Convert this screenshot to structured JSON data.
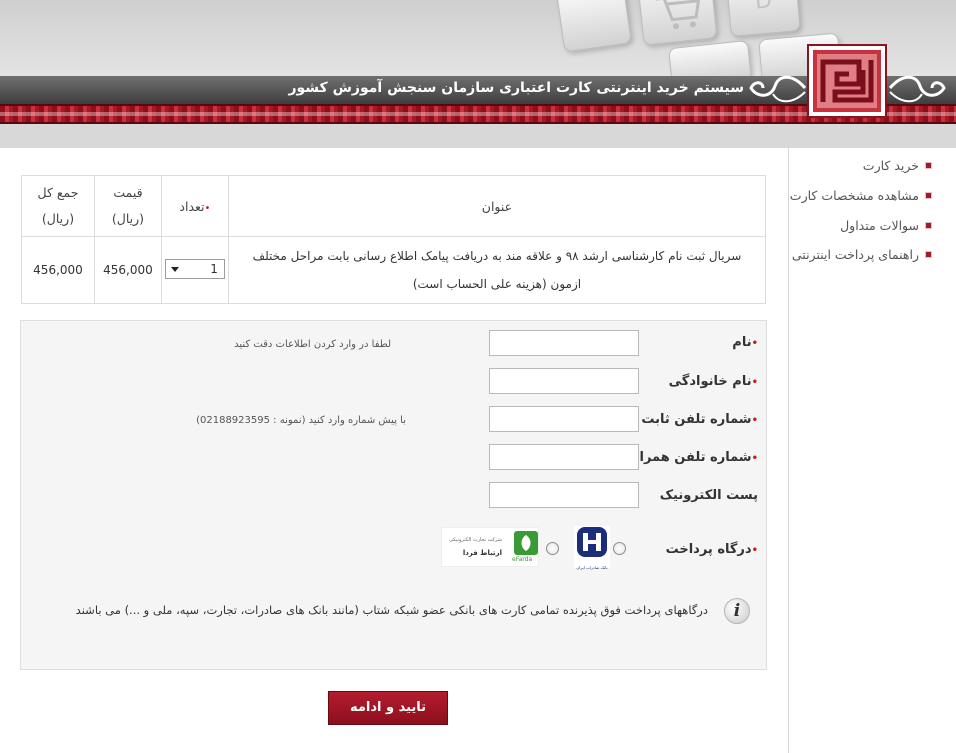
{
  "header": {
    "title": "سیستم خرید اینترنتی کارت اعتباری سازمان سنجش آموزش کشور",
    "keyboard_key_letter": "D"
  },
  "sidebar": {
    "items": [
      {
        "label": "خرید کارت"
      },
      {
        "label": "مشاهده مشخصات کارت"
      },
      {
        "label": "سوالات متداول"
      },
      {
        "label": "راهنمای پرداخت اینترنتی"
      }
    ]
  },
  "items_table": {
    "headers": {
      "title": "عنوان",
      "quantity": "تعداد",
      "price": "قیمت",
      "price_unit": "(ریال)",
      "total": "جمع کل",
      "total_unit": "(ریال)"
    },
    "rows": [
      {
        "title": "سریال ثبت نام کارشناسی ارشد ۹۸ و علاقه مند به دریافت پیامک اطلاع رسانی بابت مراحل مختلف ازمون (هزینه علی الحساب است)",
        "quantity": "1",
        "price": "456,000",
        "total": "456,000"
      }
    ]
  },
  "form": {
    "required_marker": "•",
    "fields": [
      {
        "label": "نام",
        "required": true,
        "value": "",
        "hint": "لطفا در وارد کردن اطلاعات دقت کنید"
      },
      {
        "label": "نام خانوادگی",
        "required": true,
        "value": "",
        "hint": ""
      },
      {
        "label": "شماره تلفن ثابت",
        "required": true,
        "value": "",
        "hint": "با پیش شماره وارد کنید (نمونه : 02188923595)"
      },
      {
        "label": "شماره تلفن همراه",
        "required": true,
        "value": "",
        "hint": ""
      },
      {
        "label": "پست الکترونیک",
        "required": false,
        "value": "",
        "hint": ""
      }
    ],
    "gateway": {
      "label": "درگاه پرداخت",
      "options": [
        {
          "name": "saderat-bank-logo",
          "caption": "بانک صادرات ایران"
        },
        {
          "name": "efarda-logo",
          "caption": "eFarda",
          "line1": "شرکت تجارت الکترونیکی",
          "line2": "ارتباط فردا"
        }
      ]
    },
    "info_text": "درگاههای پرداخت فوق پذیرنده تمامی کارت های بانکی عضو شبکه شتاب (مانند بانک های صادرات، تجارت، سپه، ملی و ...) می باشند"
  },
  "submit_label": "تایید و ادامه",
  "colors": {
    "brand_red": "#9e1b2c",
    "required_red": "#d01a1a",
    "saderat_blue": "#1c2e7a",
    "efarda_green": "#3a9a35"
  }
}
